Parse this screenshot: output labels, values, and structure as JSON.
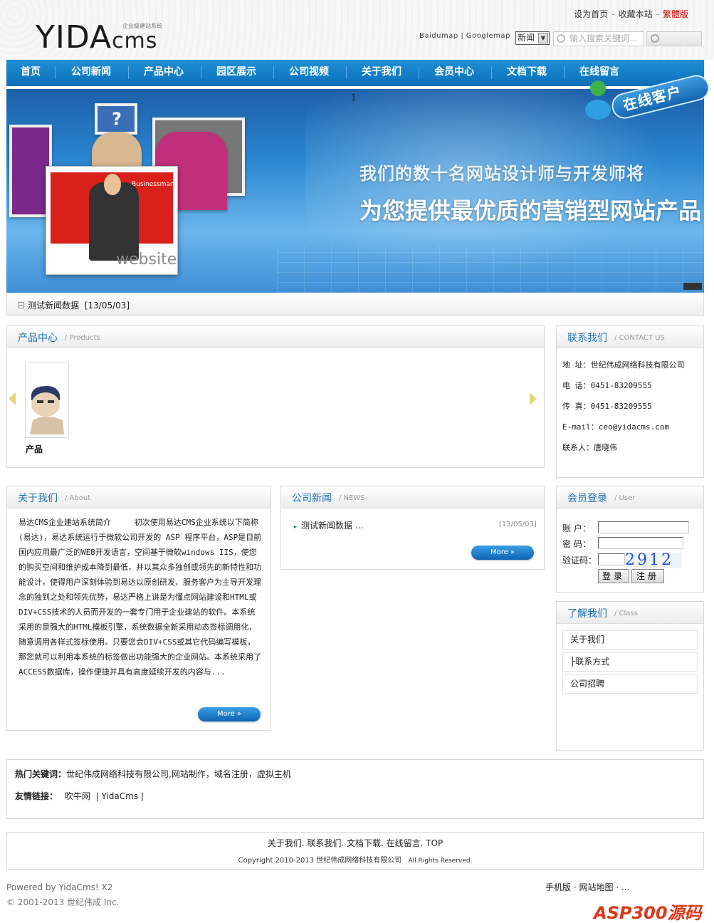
{
  "header": {
    "logo_main": "YIDA",
    "logo_cms": "cms",
    "logo_tag": "企业级建站系统",
    "top_links": [
      "设为首页",
      "收藏本站",
      "繁體版"
    ],
    "map_links": "Baidumap | Googlemap",
    "search_type": "新闻",
    "search_placeholder": "输入搜索关键词..."
  },
  "nav": [
    "首页",
    "公司新闻",
    "产品中心",
    "园区展示",
    "公司视频",
    "关于我们",
    "会员中心",
    "文档下载",
    "在线留言"
  ],
  "banner": {
    "page_number": "1",
    "line1": "我们的数十名网站设计师与开发师将",
    "line2": "为您提供最优质的营销型网站产品",
    "card_label": "Businessman",
    "card_word": "website",
    "online_badge": "在线客户"
  },
  "ticker": {
    "title": "测试新闻数据",
    "date": "[13/05/03]"
  },
  "products": {
    "title": "产品中心",
    "subtitle": "/ Products",
    "items": [
      {
        "name": "产品"
      }
    ]
  },
  "contact": {
    "title": "联系我们",
    "subtitle": "/ CONTACT US",
    "rows": [
      "地  址：世纪伟成网络科技有限公司",
      "电  话：0451-83209555",
      "传  真：0451-83209555",
      "E-mail：ceo@yidacms.com",
      "联系人：唐晓伟"
    ]
  },
  "about": {
    "title": "关于我们",
    "subtitle": "/ About",
    "text": "易达CMS企业建站系统简介　　　初次使用易达CMS企业系统以下简称(易达)，易达系统运行于微软公司开发的 ASP 程序平台，ASP是目前国内应用最广泛的WEB开发语言，空间基于微软windows IIS，使您的购买空间和维护成本降到最低，并以其众多独创或领先的新特性和功能设计，使得用户深刻体验到易达以原创研发、服务客户为主导开发理念的独到之处和领先优势，易达严格上讲是为懂点网站建设和HTML或DIV+CSS技术的人员而开发的一套专门用于企业建站的软件。本系统采用的是强大的HTML模板引擎，系统数据全新采用动态签标调用化，随意调用各样式签标使用。只要您会DIV+CSS或其它代码编写模板，那您就可以利用本系统的标签做出功能强大的企业网站。本系统采用了ACCESS数据库，操作便捷并具有高度延续开发的内容与...",
    "more": "More »"
  },
  "news": {
    "title": "公司新闻",
    "subtitle": "/ NEWS",
    "items": [
      {
        "title": "测试新闻数据 ...",
        "date": "[13/05/03]"
      }
    ],
    "more": "More »"
  },
  "login": {
    "title": "会员登录",
    "subtitle": "/ User",
    "account_label": "账  户：",
    "password_label": "密  码：",
    "captcha_label": "验证码：",
    "captcha": "2912",
    "login_btn": "登录",
    "register_btn": "注册"
  },
  "classes": {
    "title": "了解我们",
    "subtitle": "/ Class",
    "items": [
      "关于我们",
      "├联系方式",
      "公司招聘"
    ]
  },
  "keywords": {
    "label": "热门关键词：",
    "value": "世纪伟成网络科技有限公司,网站制作，域名注册，虚拟主机"
  },
  "friend_links": {
    "label": "友情链接：",
    "items": [
      "吹牛网",
      "| YidaCms |"
    ]
  },
  "footer": {
    "links": "关于我们. 联系我们. 文档下载. 在线留言. TOP",
    "copyright": "Copyright 2010-2013 世纪伟成网络科技有限公司",
    "rights": "All Rights Reserved.",
    "powered": "Powered by YidaCms! X2",
    "copy2": "© 2001-2013 世纪伟成  Inc.",
    "mobile": "手机版 · 网站地图 · ...",
    "watermark": "ASP300源码"
  },
  "colors": {
    "nav": "#0a6fb8",
    "title_blue": "#1a6fb5",
    "red_link": "#cc0000"
  }
}
